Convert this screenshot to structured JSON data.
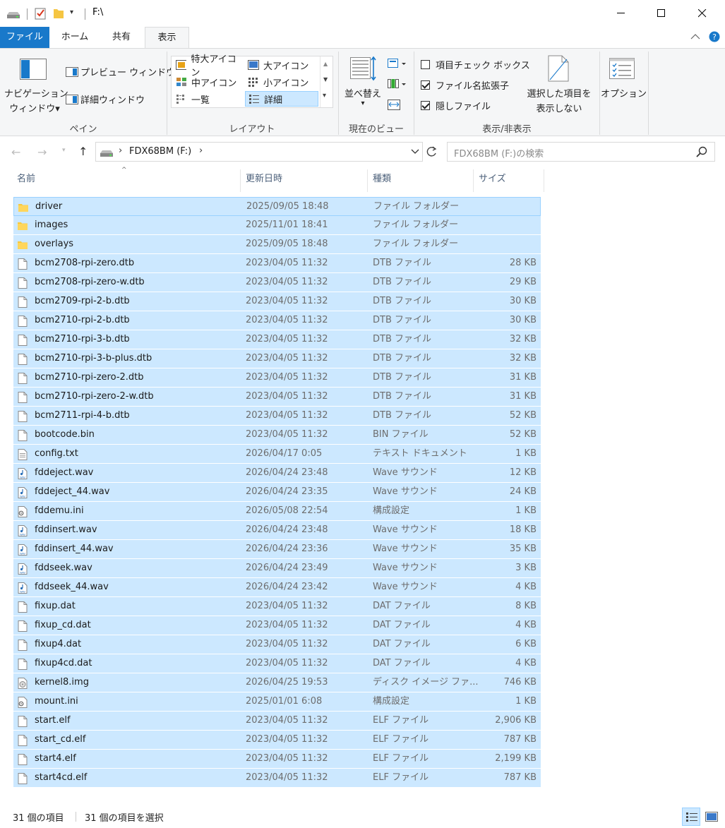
{
  "window": {
    "title": "F:\\",
    "minimize_icon": "minimize-icon",
    "maximize_icon": "maximize-icon",
    "close_icon": "close-icon"
  },
  "tabs": {
    "file": "ファイル",
    "home": "ホーム",
    "share": "共有",
    "view": "表示"
  },
  "ribbon": {
    "pane": {
      "nav_line1": "ナビゲーション",
      "nav_line2": "ウィンドウ▾",
      "preview": "プレビュー ウィンドウ",
      "details": "詳細ウィンドウ",
      "label": "ペイン"
    },
    "layout": {
      "xlarge": "特大アイコン",
      "large": "大アイコン",
      "medium": "中アイコン",
      "small": "小アイコン",
      "list": "一覧",
      "details": "詳細",
      "label": "レイアウト"
    },
    "current_view": {
      "sort_line1": "並べ替え",
      "sort_line2": "▾",
      "label": "現在のビュー"
    },
    "show_hide": {
      "item_checkboxes": "項目チェック ボックス",
      "extensions": "ファイル名拡張子",
      "hidden_items": "隠しファイル",
      "hide_selected_line1": "選択した項目を",
      "hide_selected_line2": "表示しない",
      "label": "表示/非表示",
      "item_checkboxes_checked": false,
      "extensions_checked": true,
      "hidden_checked": true
    },
    "options": "オプション"
  },
  "address": {
    "path": "FDX68BM (F:)",
    "search_placeholder": "FDX68BM (F:)の検索"
  },
  "columns": {
    "name": "名前",
    "date": "更新日時",
    "type": "種類",
    "size": "サイズ"
  },
  "files": [
    {
      "name": "driver",
      "date": "2025/09/05 18:48",
      "type": "ファイル フォルダー",
      "size": "",
      "icon": "folder"
    },
    {
      "name": "images",
      "date": "2025/11/01 18:41",
      "type": "ファイル フォルダー",
      "size": "",
      "icon": "folder"
    },
    {
      "name": "overlays",
      "date": "2025/09/05 18:48",
      "type": "ファイル フォルダー",
      "size": "",
      "icon": "folder"
    },
    {
      "name": "bcm2708-rpi-zero.dtb",
      "date": "2023/04/05 11:32",
      "type": "DTB ファイル",
      "size": "28 KB",
      "icon": "file"
    },
    {
      "name": "bcm2708-rpi-zero-w.dtb",
      "date": "2023/04/05 11:32",
      "type": "DTB ファイル",
      "size": "29 KB",
      "icon": "file"
    },
    {
      "name": "bcm2709-rpi-2-b.dtb",
      "date": "2023/04/05 11:32",
      "type": "DTB ファイル",
      "size": "30 KB",
      "icon": "file"
    },
    {
      "name": "bcm2710-rpi-2-b.dtb",
      "date": "2023/04/05 11:32",
      "type": "DTB ファイル",
      "size": "30 KB",
      "icon": "file"
    },
    {
      "name": "bcm2710-rpi-3-b.dtb",
      "date": "2023/04/05 11:32",
      "type": "DTB ファイル",
      "size": "32 KB",
      "icon": "file"
    },
    {
      "name": "bcm2710-rpi-3-b-plus.dtb",
      "date": "2023/04/05 11:32",
      "type": "DTB ファイル",
      "size": "32 KB",
      "icon": "file"
    },
    {
      "name": "bcm2710-rpi-zero-2.dtb",
      "date": "2023/04/05 11:32",
      "type": "DTB ファイル",
      "size": "31 KB",
      "icon": "file"
    },
    {
      "name": "bcm2710-rpi-zero-2-w.dtb",
      "date": "2023/04/05 11:32",
      "type": "DTB ファイル",
      "size": "31 KB",
      "icon": "file"
    },
    {
      "name": "bcm2711-rpi-4-b.dtb",
      "date": "2023/04/05 11:32",
      "type": "DTB ファイル",
      "size": "52 KB",
      "icon": "file"
    },
    {
      "name": "bootcode.bin",
      "date": "2023/04/05 11:32",
      "type": "BIN ファイル",
      "size": "52 KB",
      "icon": "file"
    },
    {
      "name": "config.txt",
      "date": "2026/04/17 0:05",
      "type": "テキスト ドキュメント",
      "size": "1 KB",
      "icon": "text"
    },
    {
      "name": "fddeject.wav",
      "date": "2026/04/24 23:48",
      "type": "Wave サウンド",
      "size": "12 KB",
      "icon": "wav"
    },
    {
      "name": "fddeject_44.wav",
      "date": "2026/04/24 23:35",
      "type": "Wave サウンド",
      "size": "24 KB",
      "icon": "wav"
    },
    {
      "name": "fddemu.ini",
      "date": "2026/05/08 22:54",
      "type": "構成設定",
      "size": "1 KB",
      "icon": "ini"
    },
    {
      "name": "fddinsert.wav",
      "date": "2026/04/24 23:48",
      "type": "Wave サウンド",
      "size": "18 KB",
      "icon": "wav"
    },
    {
      "name": "fddinsert_44.wav",
      "date": "2026/04/24 23:36",
      "type": "Wave サウンド",
      "size": "35 KB",
      "icon": "wav"
    },
    {
      "name": "fddseek.wav",
      "date": "2026/04/24 23:49",
      "type": "Wave サウンド",
      "size": "3 KB",
      "icon": "wav"
    },
    {
      "name": "fddseek_44.wav",
      "date": "2026/04/24 23:42",
      "type": "Wave サウンド",
      "size": "4 KB",
      "icon": "wav"
    },
    {
      "name": "fixup.dat",
      "date": "2023/04/05 11:32",
      "type": "DAT ファイル",
      "size": "8 KB",
      "icon": "file"
    },
    {
      "name": "fixup_cd.dat",
      "date": "2023/04/05 11:32",
      "type": "DAT ファイル",
      "size": "4 KB",
      "icon": "file"
    },
    {
      "name": "fixup4.dat",
      "date": "2023/04/05 11:32",
      "type": "DAT ファイル",
      "size": "6 KB",
      "icon": "file"
    },
    {
      "name": "fixup4cd.dat",
      "date": "2023/04/05 11:32",
      "type": "DAT ファイル",
      "size": "4 KB",
      "icon": "file"
    },
    {
      "name": "kernel8.img",
      "date": "2026/04/25 19:53",
      "type": "ディスク イメージ ファ...",
      "size": "746 KB",
      "icon": "disk"
    },
    {
      "name": "mount.ini",
      "date": "2025/01/01 6:08",
      "type": "構成設定",
      "size": "1 KB",
      "icon": "ini"
    },
    {
      "name": "start.elf",
      "date": "2023/04/05 11:32",
      "type": "ELF ファイル",
      "size": "2,906 KB",
      "icon": "file"
    },
    {
      "name": "start_cd.elf",
      "date": "2023/04/05 11:32",
      "type": "ELF ファイル",
      "size": "787 KB",
      "icon": "file"
    },
    {
      "name": "start4.elf",
      "date": "2023/04/05 11:32",
      "type": "ELF ファイル",
      "size": "2,199 KB",
      "icon": "file"
    },
    {
      "name": "start4cd.elf",
      "date": "2023/04/05 11:32",
      "type": "ELF ファイル",
      "size": "787 KB",
      "icon": "file"
    }
  ],
  "status": {
    "count": "31 個の項目",
    "selected": "31 個の項目を選択"
  },
  "colors": {
    "accent": "#1979ca",
    "selection": "#cce8ff",
    "selection_border": "#99d1ff"
  }
}
